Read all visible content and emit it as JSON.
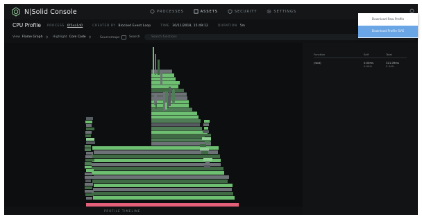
{
  "app": {
    "title": "N|Solid Console"
  },
  "nav": {
    "items": [
      {
        "label": "PROCESSES",
        "icon": "processes-icon",
        "active": false
      },
      {
        "label": "ASSETS",
        "icon": "assets-icon",
        "active": true
      },
      {
        "label": "SECURITY",
        "icon": "shield-icon",
        "active": false
      },
      {
        "label": "SETTINGS",
        "icon": "gear-icon",
        "active": false
      }
    ],
    "notification_icon": "bell-icon"
  },
  "profile": {
    "title": "CPU Profile",
    "process_label": "PROCESS",
    "process_value": "6f5ea1d0",
    "created_label": "CREATED BY",
    "created_value": "Blocked Event Loop",
    "time_label": "TIME",
    "time_value": "30/11/2018, 15:49:12",
    "duration_label": "DURATION",
    "duration_value": "5m"
  },
  "toolbar": {
    "view_label": "View",
    "view_value": "Flame Graph",
    "highlight_label": "Highlight",
    "highlight_value": "Core Code",
    "sourcemaps_label": "Sourcemaps",
    "search_label": "Search",
    "search_placeholder": "Search functions"
  },
  "function_table": {
    "headers": [
      "Function",
      "Self",
      "Total"
    ],
    "rows": [
      {
        "function": "(root)",
        "self": "0.00ms",
        "self_pct": "0.00%",
        "total": "321.09ms",
        "total_pct": "5.34%"
      }
    ]
  },
  "timeline": {
    "label": "PROFILE TIMELINE"
  },
  "download_menu": {
    "items": [
      {
        "label": "Download Raw Profile",
        "highlighted": false
      },
      {
        "label": "Download Profile SVG",
        "highlighted": true
      }
    ]
  },
  "colors": {
    "background": "#0f1112",
    "frame_green": "#6fbf73",
    "frame_dark_green": "#3f6a44",
    "frame_gray": "#6c7275",
    "root_frame": "#e4607a",
    "accent_blue": "#6aa6e6"
  }
}
